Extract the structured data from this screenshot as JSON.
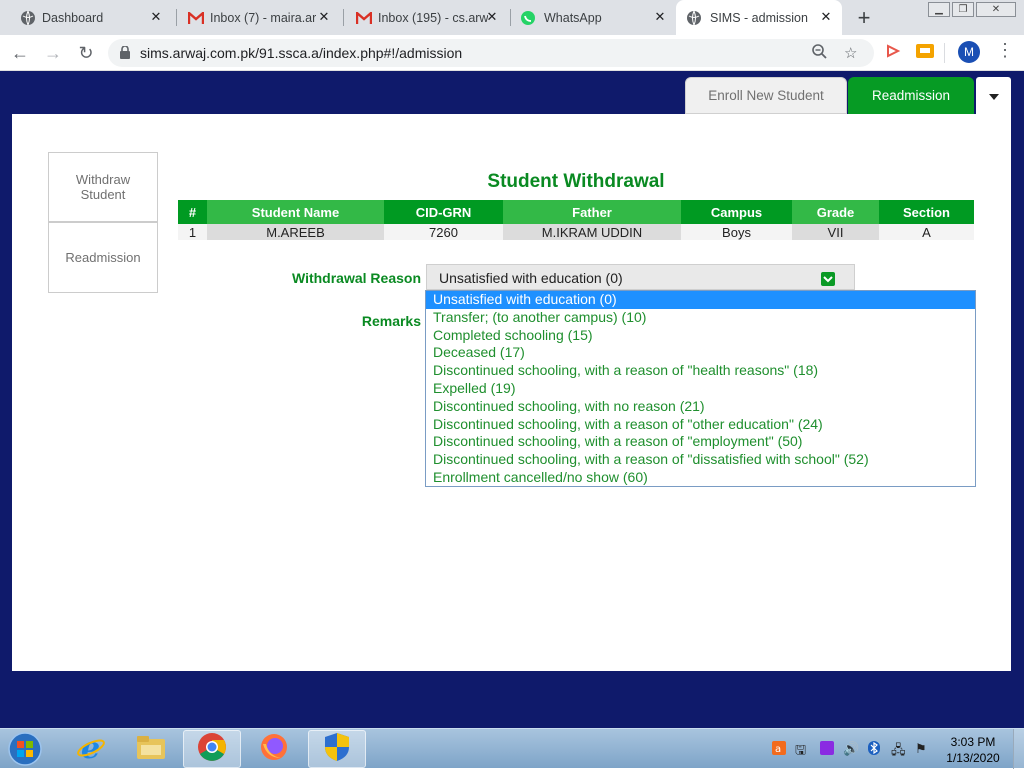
{
  "browser": {
    "tabs": [
      {
        "label": "Dashboard",
        "icon": "globe-icon"
      },
      {
        "label": "Inbox (7) - maira.ar",
        "icon": "gmail-icon"
      },
      {
        "label": "Inbox (195) - cs.arw",
        "icon": "gmail-icon"
      },
      {
        "label": "WhatsApp",
        "icon": "whatsapp-icon"
      },
      {
        "label": "SIMS - admission",
        "icon": "globe-icon",
        "active": true
      }
    ],
    "new_tab": "+",
    "url": "sims.arwaj.com.pk/91.ssca.a/index.php#!/admission",
    "profile_initial": "M"
  },
  "top_tabs": {
    "enroll": "Enroll New Student",
    "readmission": "Readmission"
  },
  "sidebar": {
    "withdraw": "Withdraw Student",
    "readmission": "Readmission"
  },
  "form": {
    "title": "Student Withdrawal",
    "columns": [
      "#",
      "Student Name",
      "CID-GRN",
      "Father",
      "Campus",
      "Grade",
      "Section"
    ],
    "rows": [
      [
        "1",
        "M.AREEB",
        "7260",
        "M.IKRAM UDDIN",
        "Boys",
        "VII",
        "A"
      ]
    ],
    "reason_label": "Withdrawal Reason",
    "remarks_label": "Remarks",
    "reason_selected": "Unsatisfied with education (0)",
    "reason_options": [
      "Unsatisfied with education (0)",
      "Transfer; (to another campus) (10)",
      "Completed schooling (15)",
      "Deceased (17)",
      "Discontinued schooling, with a reason of \"health reasons\" (18)",
      "Expelled (19)",
      "Discontinued schooling, with no reason (21)",
      "Discontinued schooling, with a reason of \"other education\" (24)",
      "Discontinued schooling, with a reason of \"employment\" (50)",
      "Discontinued schooling, with a reason of \"dissatisfied with school\" (52)",
      "Enrollment cancelled/no show (60)"
    ]
  },
  "taskbar": {
    "time": "3:03 PM",
    "date": "1/13/2020"
  },
  "colors": {
    "page_bg": "#0f1a6b",
    "brand_green": "#069b24",
    "header_green_dark": "#009a22",
    "header_green_light": "#33b947",
    "selected_option": "#1e90ff"
  }
}
